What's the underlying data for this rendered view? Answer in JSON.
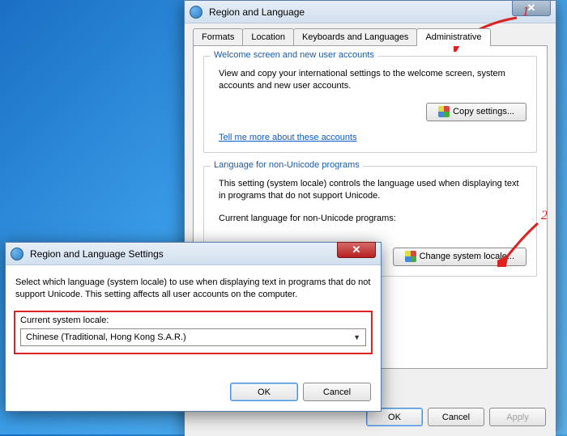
{
  "mainDialog": {
    "title": "Region and Language",
    "tabs": [
      "Formats",
      "Location",
      "Keyboards and Languages",
      "Administrative"
    ],
    "group1": {
      "legend": "Welcome screen and new user accounts",
      "text": "View and copy your international settings to the welcome screen, system accounts and new user accounts.",
      "button": "Copy settings...",
      "link": "Tell me more about these accounts"
    },
    "group2": {
      "legend": "Language for non-Unicode programs",
      "text": "This setting (system locale) controls the language used when displaying text in programs that do not support Unicode.",
      "label": "Current language for non-Unicode programs:",
      "button": "Change system locale..."
    },
    "buttons": {
      "ok": "OK",
      "cancel": "Cancel",
      "apply": "Apply"
    }
  },
  "selDialog": {
    "title": "Region and Language Settings",
    "desc": "Select which language (system locale) to use when displaying text in programs that do not support Unicode. This setting affects all user accounts on the computer.",
    "label": "Current system locale:",
    "value": "Chinese (Traditional, Hong Kong S.A.R.)",
    "ok": "OK",
    "cancel": "Cancel"
  },
  "annot": {
    "n1": "1",
    "n2": "2"
  }
}
